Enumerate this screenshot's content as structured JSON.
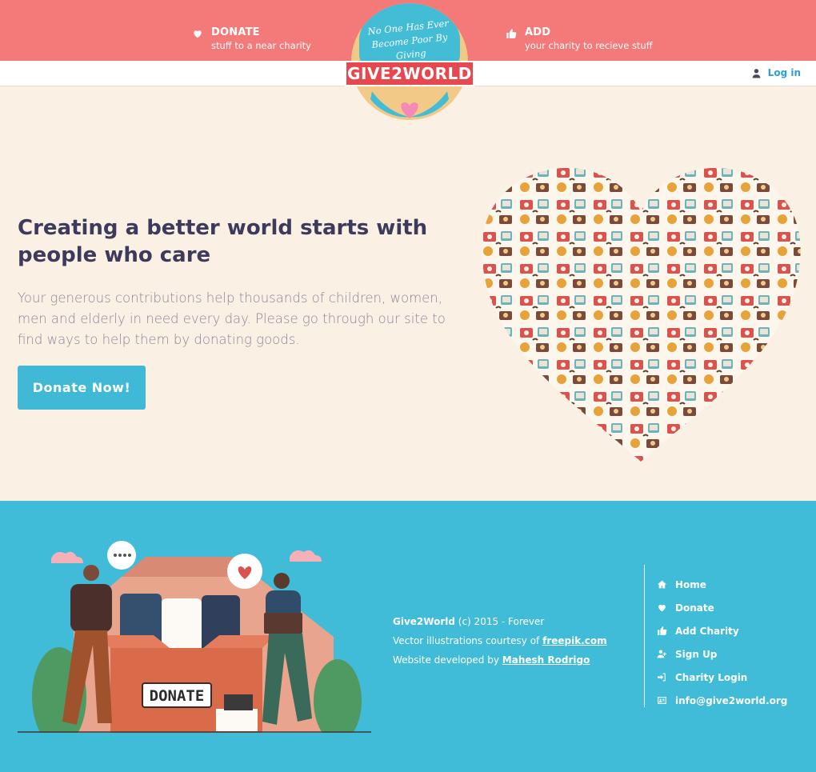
{
  "header": {
    "donate": {
      "title": "DONATE",
      "subtitle": "stuff to a near charity"
    },
    "add": {
      "title": "ADD",
      "subtitle": "your charity to recieve stuff"
    },
    "logo": {
      "slogan": "No One Has Ever Become Poor By Giving",
      "brand": "GIVE2WORLD"
    },
    "login_label": "Log in"
  },
  "hero": {
    "title": "Creating a better world starts with people who care",
    "text": "Your generous contributions help thousands of children, women, men and elderly in need every day. Please go through our site to find ways to help them by donating goods.",
    "button_label": "Donate Now!"
  },
  "illustration": {
    "box_label": "DONATE"
  },
  "footer": {
    "brand": "Give2World",
    "copyright": "(c) 2015 - Forever",
    "vector_prefix": "Vector illustrations courtesy of",
    "vector_link": "freepik.com",
    "dev_prefix": "Website developed by",
    "dev_link": "Mahesh Rodrigo",
    "nav": [
      {
        "label": "Home",
        "icon": "home-icon"
      },
      {
        "label": "Donate",
        "icon": "heart-icon"
      },
      {
        "label": "Add Charity",
        "icon": "thumbs-up-icon"
      },
      {
        "label": "Sign Up",
        "icon": "user-plus-icon"
      },
      {
        "label": "Charity Login",
        "icon": "sign-in-icon"
      },
      {
        "label": "info@give2world.org",
        "icon": "id-card-icon"
      }
    ]
  },
  "colors": {
    "header": "#f47a7a",
    "accent": "#40b9d6",
    "background": "#fbf0e4",
    "heading": "#3d3a5c",
    "link": "#2a9fd8"
  }
}
